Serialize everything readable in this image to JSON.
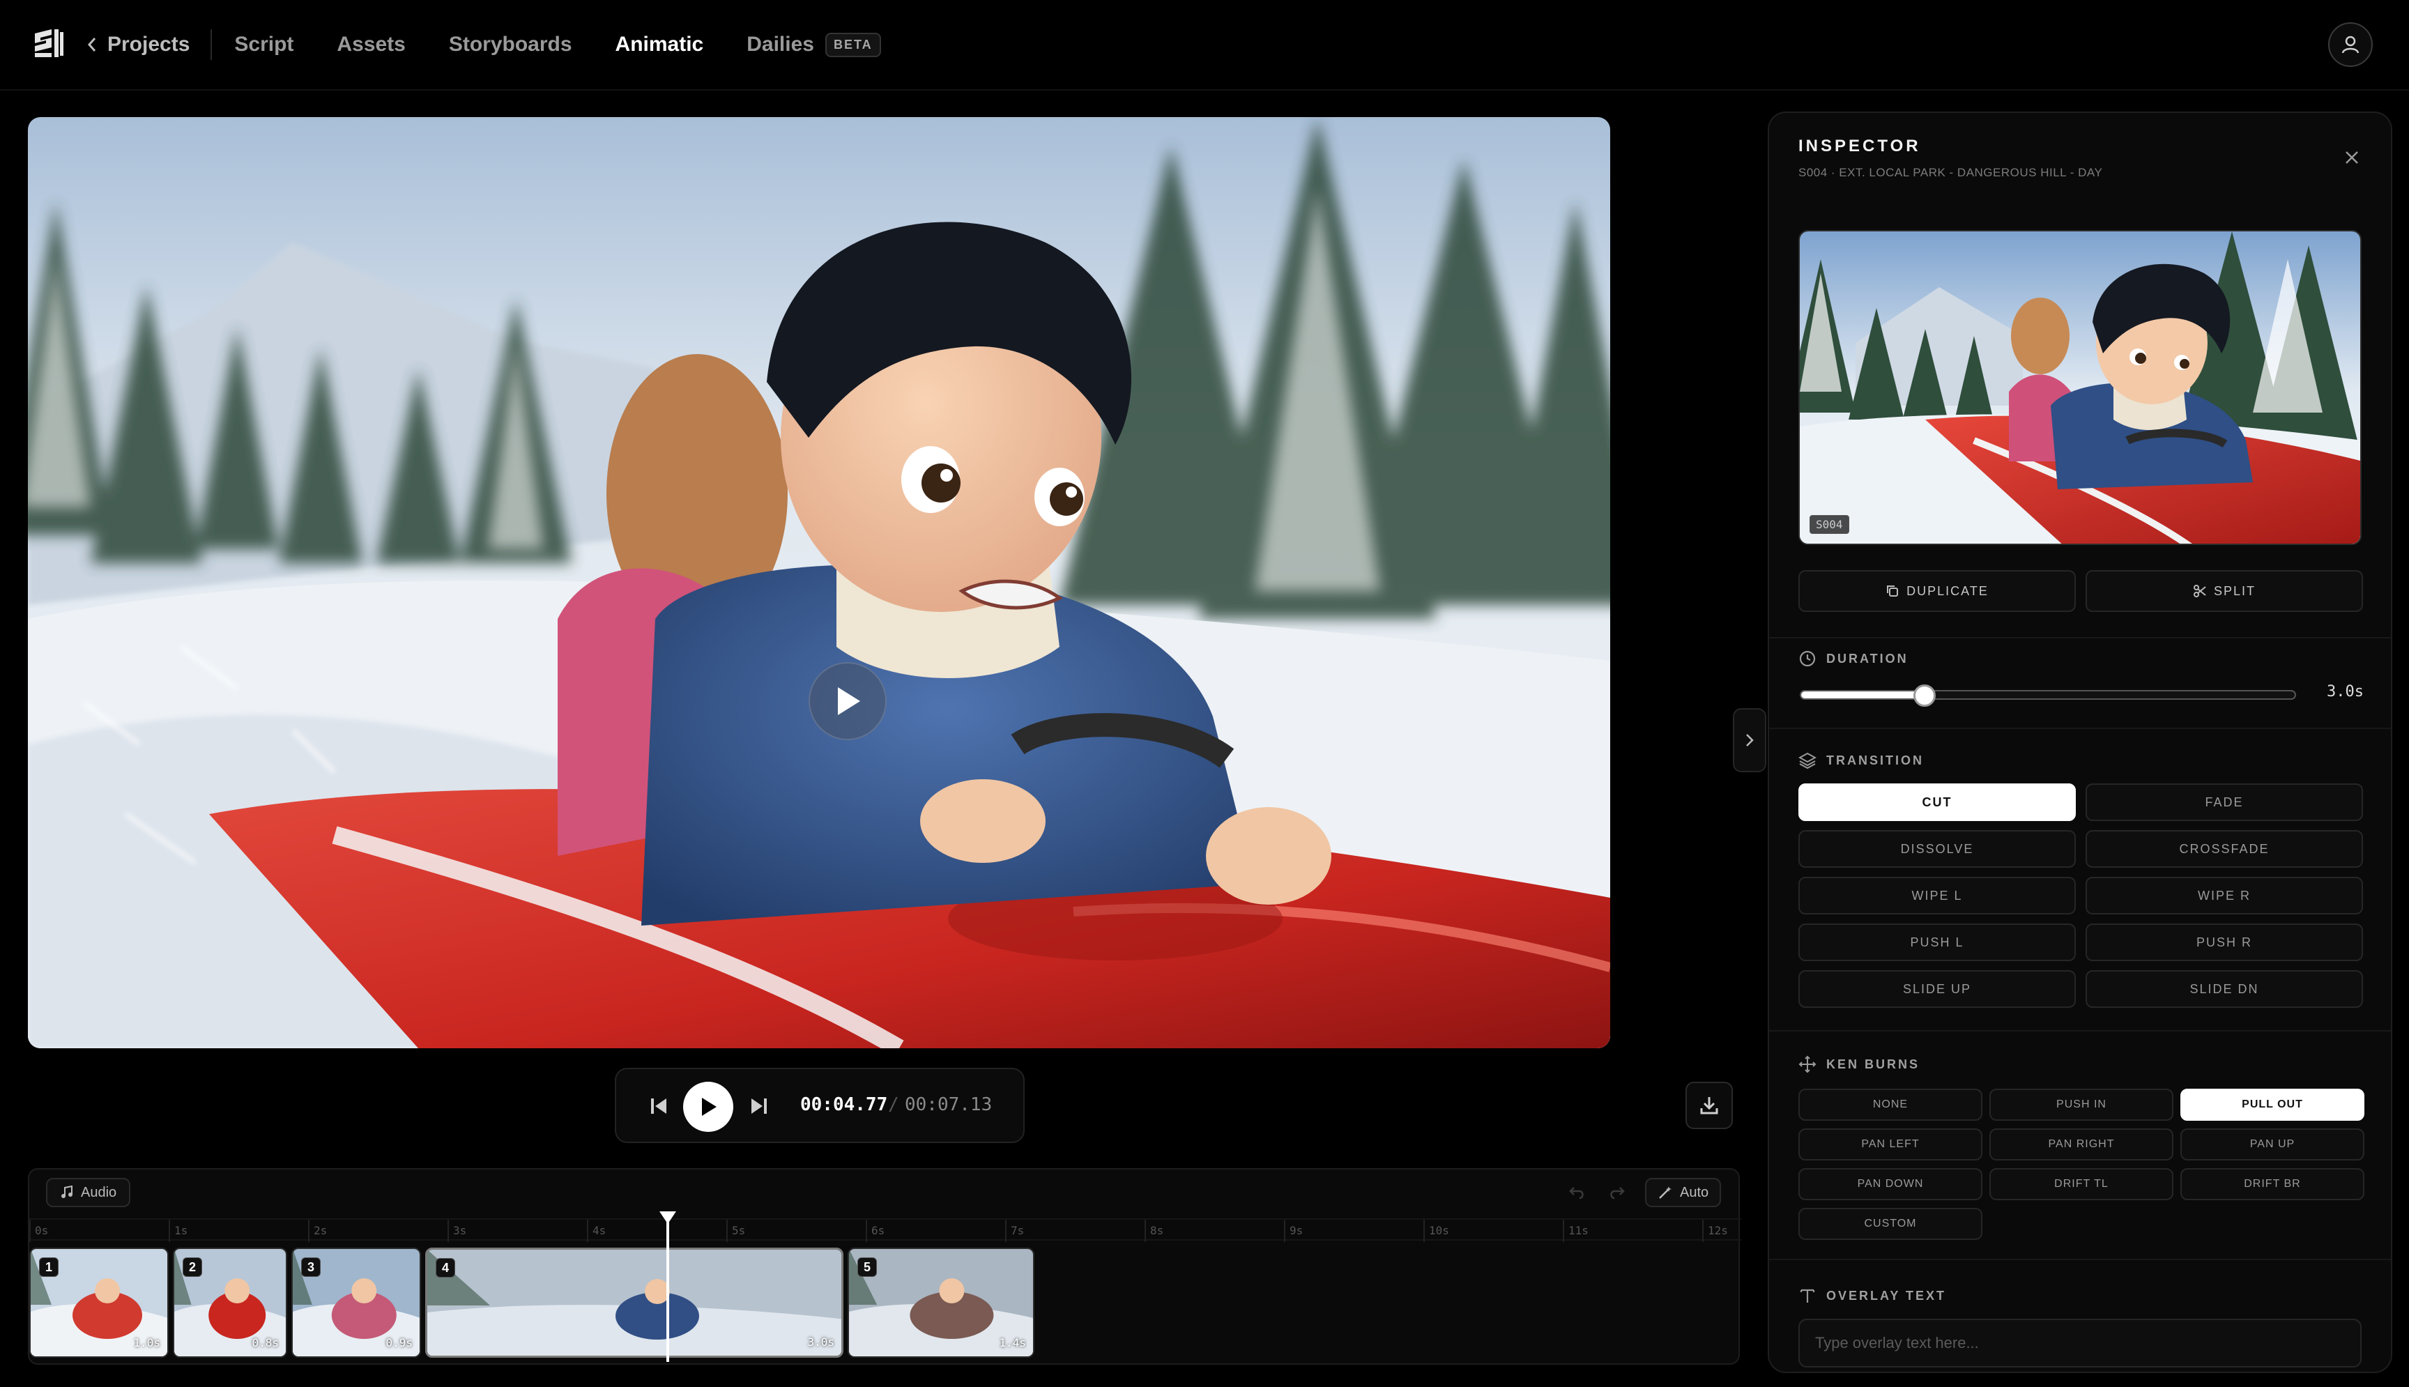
{
  "nav": {
    "back_label": "Projects",
    "items": [
      {
        "label": "Script",
        "active": false
      },
      {
        "label": "Assets",
        "active": false
      },
      {
        "label": "Storyboards",
        "active": false
      },
      {
        "label": "Animatic",
        "active": true
      },
      {
        "label": "Dailies",
        "active": false
      }
    ],
    "beta_badge": "BETA"
  },
  "transport": {
    "current_time": "00:04.77",
    "separator": "/",
    "total_time": "00:07.13"
  },
  "timeline": {
    "audio_label": "Audio",
    "auto_label": "Auto",
    "ticks": [
      "0s",
      "1s",
      "2s",
      "3s",
      "4s",
      "5s",
      "6s",
      "7s",
      "8s",
      "9s",
      "10s",
      "11s",
      "12s"
    ],
    "clips": [
      {
        "number": "1",
        "duration": "1.0s",
        "selected": false
      },
      {
        "number": "2",
        "duration": "0.8s",
        "selected": false
      },
      {
        "number": "3",
        "duration": "0.9s",
        "selected": false
      },
      {
        "number": "4",
        "duration": "3.0s",
        "selected": true
      },
      {
        "number": "5",
        "duration": "1.4s",
        "selected": false
      }
    ]
  },
  "inspector": {
    "title": "INSPECTOR",
    "subtitle": "S004 · EXT. LOCAL PARK - DANGEROUS HILL - DAY",
    "thumb_badge": "S004",
    "duplicate_label": "DUPLICATE",
    "split_label": "SPLIT",
    "duration": {
      "label": "DURATION",
      "value_text": "3.0s",
      "level_fraction": 0.25
    },
    "transition": {
      "label": "TRANSITION",
      "options": [
        "CUT",
        "FADE",
        "DISSOLVE",
        "CROSSFADE",
        "WIPE L",
        "WIPE R",
        "PUSH L",
        "PUSH R",
        "SLIDE UP",
        "SLIDE DN"
      ],
      "selected": "CUT"
    },
    "ken_burns": {
      "label": "KEN BURNS",
      "options": [
        "NONE",
        "PUSH IN",
        "PULL OUT",
        "PAN LEFT",
        "PAN RIGHT",
        "PAN UP",
        "PAN DOWN",
        "DRIFT TL",
        "DRIFT BR",
        "CUSTOM"
      ],
      "selected": "PULL OUT"
    },
    "overlay_text": {
      "label": "OVERLAY TEXT",
      "placeholder": "Type overlay text here..."
    }
  }
}
